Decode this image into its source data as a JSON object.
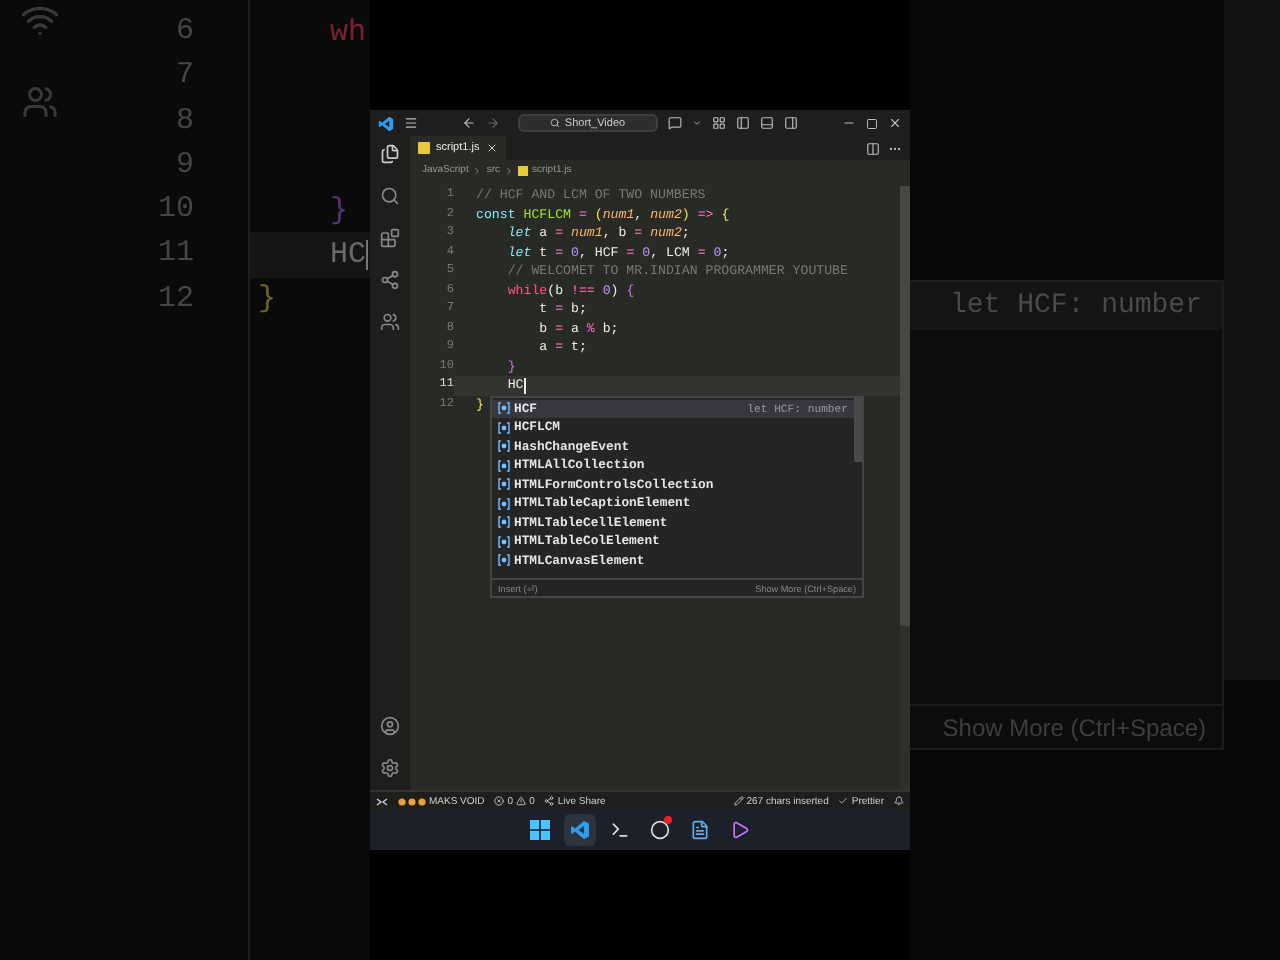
{
  "background_left": {
    "lines": [
      {
        "number": "6",
        "text": "    wh",
        "kind": "control",
        "active": false
      },
      {
        "number": "7",
        "active": false
      },
      {
        "number": "8",
        "active": false
      },
      {
        "number": "9",
        "active": false
      },
      {
        "number": "10",
        "text": "    }",
        "kind": "brace2",
        "active": false
      },
      {
        "number": "11",
        "text": "    HC",
        "kind": "text",
        "active": true
      },
      {
        "number": "12",
        "text": "}",
        "kind": "brace1",
        "active": false
      }
    ]
  },
  "window": {
    "search": "Short_Video",
    "tabs": [
      {
        "label": "script1.js",
        "selected": true
      }
    ],
    "breadcrumb": [
      "JavaScript",
      "src",
      "script1.js"
    ],
    "code": [
      {
        "number": "1",
        "active": false,
        "tokens": [
          {
            "text": "// HCF AND LCM OF TWO NUMBERS",
            "kind": "comment"
          }
        ]
      },
      {
        "number": "2",
        "active": false,
        "tokens": [
          {
            "text": "const ",
            "kind": "storage"
          },
          {
            "text": "HCFLCM",
            "kind": "fn"
          },
          {
            "text": " = ",
            "kind": "op"
          },
          {
            "text": "(",
            "kind": "brace1"
          },
          {
            "text": "num1",
            "kind": "param"
          },
          {
            "text": ", ",
            "kind": "text"
          },
          {
            "text": "num2",
            "kind": "param"
          },
          {
            "text": ") ",
            "kind": "brace1"
          },
          {
            "text": "=>",
            "kind": "op"
          },
          {
            "text": " {",
            "kind": "brace1"
          }
        ]
      },
      {
        "number": "3",
        "active": false,
        "tokens": [
          {
            "text": "    let",
            "kind": "decl"
          },
          {
            "text": " a ",
            "kind": "text"
          },
          {
            "text": "= ",
            "kind": "op"
          },
          {
            "text": "num1",
            "kind": "param"
          },
          {
            "text": ", b ",
            "kind": "text"
          },
          {
            "text": "= ",
            "kind": "op"
          },
          {
            "text": "num2",
            "kind": "param"
          },
          {
            "text": ";",
            "kind": "text"
          }
        ]
      },
      {
        "number": "4",
        "active": false,
        "tokens": [
          {
            "text": "    let",
            "kind": "decl"
          },
          {
            "text": " t ",
            "kind": "text"
          },
          {
            "text": "= ",
            "kind": "op"
          },
          {
            "text": "0",
            "kind": "num"
          },
          {
            "text": ", HCF ",
            "kind": "text"
          },
          {
            "text": "= ",
            "kind": "op"
          },
          {
            "text": "0",
            "kind": "num"
          },
          {
            "text": ", LCM ",
            "kind": "text"
          },
          {
            "text": "= ",
            "kind": "op"
          },
          {
            "text": "0",
            "kind": "num"
          },
          {
            "text": ";",
            "kind": "text"
          }
        ]
      },
      {
        "number": "5",
        "active": false,
        "tokens": [
          {
            "text": "    // WELCOMET TO MR.INDIAN PROGRAMMER YOUTUBE",
            "kind": "comment"
          }
        ]
      },
      {
        "number": "6",
        "active": false,
        "tokens": [
          {
            "text": "    while",
            "kind": "control"
          },
          {
            "text": "(b ",
            "kind": "text"
          },
          {
            "text": "!==",
            "kind": "op"
          },
          {
            "text": " 0",
            "kind": "num"
          },
          {
            "text": ") ",
            "kind": "text"
          },
          {
            "text": "{",
            "kind": "brace2"
          }
        ]
      },
      {
        "number": "7",
        "active": false,
        "tokens": [
          {
            "text": "        t ",
            "kind": "text"
          },
          {
            "text": "= ",
            "kind": "op"
          },
          {
            "text": "b;",
            "kind": "text"
          }
        ]
      },
      {
        "number": "8",
        "active": false,
        "tokens": [
          {
            "text": "        b ",
            "kind": "text"
          },
          {
            "text": "= ",
            "kind": "op"
          },
          {
            "text": "a ",
            "kind": "text"
          },
          {
            "text": "%",
            "kind": "op"
          },
          {
            "text": " b;",
            "kind": "text"
          }
        ]
      },
      {
        "number": "9",
        "active": false,
        "tokens": [
          {
            "text": "        a ",
            "kind": "text"
          },
          {
            "text": "= ",
            "kind": "op"
          },
          {
            "text": "t;",
            "kind": "text"
          }
        ]
      },
      {
        "number": "10",
        "active": false,
        "tokens": [
          {
            "text": "    }",
            "kind": "brace2"
          }
        ]
      },
      {
        "number": "11",
        "active": true,
        "tokens": [
          {
            "text": "    HC",
            "kind": "text"
          }
        ]
      },
      {
        "number": "12",
        "active": false,
        "tokens": [
          {
            "text": "}",
            "kind": "brace1"
          }
        ]
      }
    ],
    "suggestions": [
      {
        "label": "HCF",
        "detail": "let HCF: number",
        "selected": true
      },
      {
        "label": "HCFLCM",
        "selected": false
      },
      {
        "label": "HashChangeEvent",
        "selected": false
      },
      {
        "label": "HTMLAllCollection",
        "selected": false
      },
      {
        "label": "HTMLFormControlsCollection",
        "selected": false
      },
      {
        "label": "HTMLTableCaptionElement",
        "selected": false
      },
      {
        "label": "HTMLTableCellElement",
        "selected": false
      },
      {
        "label": "HTMLTableColElement",
        "selected": false
      },
      {
        "label": "HTMLCanvasElement",
        "selected": false
      }
    ],
    "suggest_footer": {
      "insert": "Insert (⏎)",
      "more": "Show More (Ctrl+Space)"
    },
    "status_bar": {
      "user": "MAKS VOID",
      "errors": "0",
      "warnings": "0",
      "live_share": "Live Share",
      "inserted": "267 chars inserted",
      "formatter": "Prettier"
    },
    "taskbar": [
      {
        "kind": "start",
        "selected": false,
        "badge": false
      },
      {
        "kind": "vscode",
        "selected": true,
        "badge": false
      },
      {
        "kind": "terminal",
        "selected": false,
        "badge": false
      },
      {
        "kind": "recorder",
        "selected": false,
        "badge": true
      },
      {
        "kind": "notepad",
        "selected": false,
        "badge": false
      },
      {
        "kind": "player",
        "selected": false,
        "badge": false
      }
    ]
  },
  "background_right": {
    "detail": "let HCF: number",
    "footer": "Show More (Ctrl+Space)"
  }
}
